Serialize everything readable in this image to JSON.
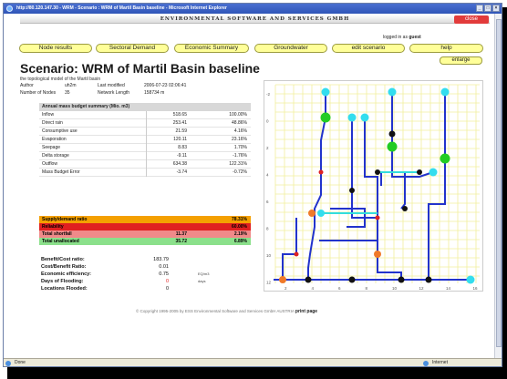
{
  "window": {
    "title": "http://80.120.147.30 - WRM - Scenario : WRM of Martil Basin baseline - Microsoft Internet Explorer",
    "controls": [
      "_",
      "□",
      "×"
    ]
  },
  "banner": {
    "org_name": "ENVIRONMENTAL SOFTWARE AND SERVICES GMBH",
    "close_label": "close"
  },
  "login": {
    "prefix": "logged in as",
    "user": "guest"
  },
  "nav": {
    "items": [
      {
        "label": "Node results"
      },
      {
        "label": "Sectoral Demand"
      },
      {
        "label": "Economic Summary"
      },
      {
        "label": "Groundwater"
      },
      {
        "label": "edit scenario"
      },
      {
        "label": "help"
      }
    ],
    "enlarge": "enlarge"
  },
  "scenario": {
    "title": "Scenario: WRM of Martil Basin baseline",
    "subtitle": "the topological model of the Martil basin",
    "author_label": "Author",
    "author": "uh2m",
    "last_modified_label": "Last modified",
    "last_modified": "2006-07-23 02:06:41",
    "nodes_label": "Number of Nodes",
    "nodes": "35",
    "network_length_label": "Network Length",
    "network_length": "158734 m"
  },
  "mass_budget": {
    "header": "Annual mass budget summary (Mio. m3)",
    "rows": [
      {
        "label": "Inflow",
        "value": "518.65",
        "pct": "100.00%"
      },
      {
        "label": "Direct rain",
        "value": "253.41",
        "pct": "48.86%"
      },
      {
        "label": "Consumptive use",
        "value": "21.59",
        "pct": "4.16%"
      },
      {
        "label": "Evaporation",
        "value": "120.11",
        "pct": "23.16%"
      },
      {
        "label": "Seepage",
        "value": "8.83",
        "pct": "1.70%"
      },
      {
        "label": "Delta storage",
        "value": "-9.11",
        "pct": "-1.76%"
      },
      {
        "label": "Outflow",
        "value": "634.38",
        "pct": "122.31%"
      },
      {
        "label": "Mass Budget Error",
        "value": "-3.74",
        "pct": "-0.72%"
      }
    ]
  },
  "supply_demand": {
    "rows": [
      {
        "label": "Supply/demand ratio",
        "value": "",
        "pct": "78.31%",
        "color": "#f4a000"
      },
      {
        "label": "Reliability",
        "value": "",
        "pct": "60.00%",
        "color": "#e02020"
      },
      {
        "label": "Total shortfall",
        "value": "11.37",
        "pct": "2.19%",
        "color": "#f08a8a"
      },
      {
        "label": "Total unallocated",
        "value": "35.72",
        "pct": "6.89%",
        "color": "#8be08b"
      }
    ]
  },
  "metrics": {
    "rows": [
      {
        "label": "Benefit/Cost ratio:",
        "value": "183.79",
        "unit": ""
      },
      {
        "label": "Cost/Benefit Ratio:",
        "value": "0.01",
        "unit": ""
      },
      {
        "label": "Economic efficiency:",
        "value": "0.75",
        "unit": "EQ/m3"
      },
      {
        "label": "Days of Flooding:",
        "value": "0",
        "unit": "days"
      },
      {
        "label": "Locations Flooded:",
        "value": "0",
        "unit": ""
      }
    ],
    "flood_value_color": "#e02020"
  },
  "footer": {
    "copyright": "© Copyright 1995-2005 by   ESS  Environmental Software and Services GmbH AUSTRIA",
    "print": "print page"
  },
  "map": {
    "y_ticks": [
      "-2",
      "0",
      "2",
      "4",
      "6",
      "8",
      "10",
      "12"
    ],
    "x_ticks": [
      "2",
      "4",
      "6",
      "8",
      "10",
      "12",
      "14",
      "16"
    ],
    "grid_color": "#f1ef9c",
    "river_color": "#2233cc",
    "canal_color": "#33dddd",
    "colors": {
      "node_cyan": "#33ddee",
      "node_green": "#22cc22",
      "node_black": "#111111",
      "node_orange": "#f07a2a",
      "node_red": "#dd2222"
    }
  },
  "statusbar": {
    "done": "Done",
    "zone": "Internet"
  }
}
